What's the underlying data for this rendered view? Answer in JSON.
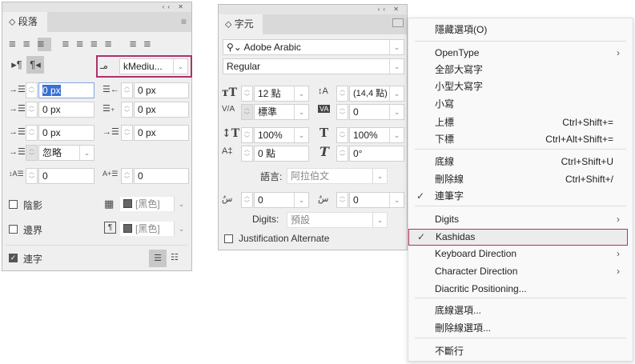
{
  "paragraph_panel": {
    "tab": "段落",
    "composer": "kMediu...",
    "indent_left": "0 px",
    "indent_right": "0 px",
    "first_line": "0 px",
    "last_line": "0 px",
    "space_before": "0 px",
    "space_after": "0 px",
    "drop_cap": "忽略",
    "drop_lines": "0",
    "drop_chars": "0",
    "shading_label": "陰影",
    "shading_color": "[黑色]",
    "border_label": "邊界",
    "border_color": "[黑色]",
    "hyphen_label": "連字"
  },
  "character_panel": {
    "tab": "字元",
    "font": "Adobe Arabic",
    "style": "Regular",
    "size": "12 點",
    "leading": "(14,4 點)",
    "kerning": "標準",
    "tracking": "0",
    "vscale": "100%",
    "hscale": "100%",
    "baseline": "0 點",
    "skew": "0°",
    "language_label": "語言:",
    "language": "阿拉伯文",
    "diacritic_x": "0",
    "diacritic_y": "0",
    "digits_label": "Digits:",
    "digits": "預設",
    "justification_alternate": "Justification Alternate"
  },
  "menu": {
    "items": [
      {
        "label": "隱藏選項(O)"
      },
      {
        "label": "OpenType",
        "submenu": true
      },
      {
        "label": "全部大寫字"
      },
      {
        "label": "小型大寫字"
      },
      {
        "label": "小寫"
      },
      {
        "label": "上標",
        "shortcut": "Ctrl+Shift+="
      },
      {
        "label": "下標",
        "shortcut": "Ctrl+Alt+Shift+="
      },
      {
        "label": "底線",
        "shortcut": "Ctrl+Shift+U"
      },
      {
        "label": "刪除線",
        "shortcut": "Ctrl+Shift+/"
      },
      {
        "label": "連筆字",
        "checked": true
      },
      {
        "label": "Digits",
        "submenu": true
      },
      {
        "label": "Kashidas",
        "checked": true
      },
      {
        "label": "Keyboard Direction",
        "submenu": true
      },
      {
        "label": "Character Direction",
        "submenu": true
      },
      {
        "label": "Diacritic Positioning..."
      },
      {
        "label": "底線選項..."
      },
      {
        "label": "刪除線選項..."
      },
      {
        "label": "不斷行"
      }
    ]
  },
  "colors": {
    "highlight": "#b0306a",
    "selection": "#3a6fd1"
  }
}
